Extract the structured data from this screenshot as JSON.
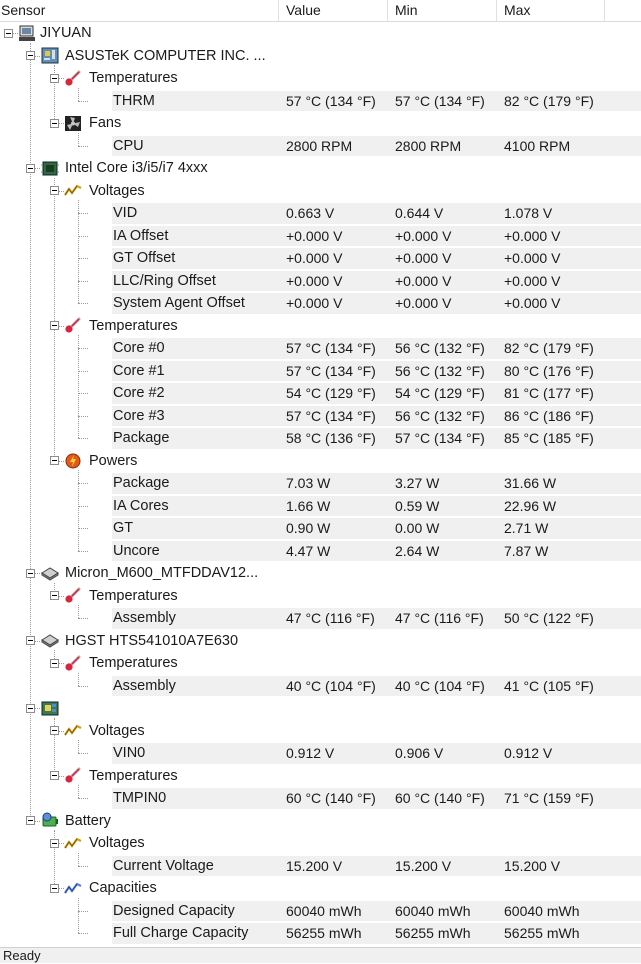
{
  "columns": {
    "sensor": "Sensor",
    "value": "Value",
    "min": "Min",
    "max": "Max"
  },
  "status": "Ready",
  "rows": [
    {
      "level": 0,
      "type": "computer",
      "icon": "computer-icon",
      "label": "JIYUAN"
    },
    {
      "level": 1,
      "type": "device",
      "icon": "motherboard-icon",
      "label": "ASUSTeK COMPUTER INC. ..."
    },
    {
      "level": 2,
      "type": "group",
      "icon": "thermometer-icon",
      "label": "Temperatures"
    },
    {
      "level": 3,
      "type": "sensor",
      "label": "THRM",
      "value": "57 °C  (134 °F)",
      "min": "57 °C  (134 °F)",
      "max": "82 °C  (179 °F)"
    },
    {
      "level": 2,
      "type": "group",
      "icon": "fan-icon",
      "label": "Fans"
    },
    {
      "level": 3,
      "type": "sensor",
      "label": "CPU",
      "value": "2800 RPM",
      "min": "2800 RPM",
      "max": "4100 RPM"
    },
    {
      "level": 1,
      "type": "device",
      "icon": "cpu-icon",
      "label": "Intel Core i3/i5/i7 4xxx"
    },
    {
      "level": 2,
      "type": "group",
      "icon": "voltage-icon",
      "label": "Voltages"
    },
    {
      "level": 3,
      "type": "sensor",
      "label": "VID",
      "value": "0.663 V",
      "min": "0.644 V",
      "max": "1.078 V"
    },
    {
      "level": 3,
      "type": "sensor",
      "label": "IA Offset",
      "value": "+0.000 V",
      "min": "+0.000 V",
      "max": "+0.000 V"
    },
    {
      "level": 3,
      "type": "sensor",
      "label": "GT Offset",
      "value": "+0.000 V",
      "min": "+0.000 V",
      "max": "+0.000 V"
    },
    {
      "level": 3,
      "type": "sensor",
      "label": "LLC/Ring Offset",
      "value": "+0.000 V",
      "min": "+0.000 V",
      "max": "+0.000 V"
    },
    {
      "level": 3,
      "type": "sensor",
      "label": "System Agent Offset",
      "value": "+0.000 V",
      "min": "+0.000 V",
      "max": "+0.000 V"
    },
    {
      "level": 2,
      "type": "group",
      "icon": "thermometer-icon",
      "label": "Temperatures"
    },
    {
      "level": 3,
      "type": "sensor",
      "label": "Core #0",
      "value": "57 °C  (134 °F)",
      "min": "56 °C  (132 °F)",
      "max": "82 °C  (179 °F)"
    },
    {
      "level": 3,
      "type": "sensor",
      "label": "Core #1",
      "value": "57 °C  (134 °F)",
      "min": "56 °C  (132 °F)",
      "max": "80 °C  (176 °F)"
    },
    {
      "level": 3,
      "type": "sensor",
      "label": "Core #2",
      "value": "54 °C  (129 °F)",
      "min": "54 °C  (129 °F)",
      "max": "81 °C  (177 °F)"
    },
    {
      "level": 3,
      "type": "sensor",
      "label": "Core #3",
      "value": "57 °C  (134 °F)",
      "min": "56 °C  (132 °F)",
      "max": "86 °C  (186 °F)"
    },
    {
      "level": 3,
      "type": "sensor",
      "label": "Package",
      "value": "58 °C  (136 °F)",
      "min": "57 °C  (134 °F)",
      "max": "85 °C  (185 °F)"
    },
    {
      "level": 2,
      "type": "group",
      "icon": "power-icon",
      "label": "Powers"
    },
    {
      "level": 3,
      "type": "sensor",
      "label": "Package",
      "value": "7.03 W",
      "min": "3.27 W",
      "max": "31.66 W"
    },
    {
      "level": 3,
      "type": "sensor",
      "label": "IA Cores",
      "value": "1.66 W",
      "min": "0.59 W",
      "max": "22.96 W"
    },
    {
      "level": 3,
      "type": "sensor",
      "label": "GT",
      "value": "0.90 W",
      "min": "0.00 W",
      "max": "2.71 W"
    },
    {
      "level": 3,
      "type": "sensor",
      "label": "Uncore",
      "value": "4.47 W",
      "min": "2.64 W",
      "max": "7.87 W"
    },
    {
      "level": 1,
      "type": "device",
      "icon": "disk-icon",
      "label": "Micron_M600_MTFDDAV12..."
    },
    {
      "level": 2,
      "type": "group",
      "icon": "thermometer-icon",
      "label": "Temperatures"
    },
    {
      "level": 3,
      "type": "sensor",
      "label": "Assembly",
      "value": "47 °C  (116 °F)",
      "min": "47 °C  (116 °F)",
      "max": "50 °C  (122 °F)"
    },
    {
      "level": 1,
      "type": "device",
      "icon": "disk-icon",
      "label": "HGST HTS541010A7E630"
    },
    {
      "level": 2,
      "type": "group",
      "icon": "thermometer-icon",
      "label": "Temperatures"
    },
    {
      "level": 3,
      "type": "sensor",
      "label": "Assembly",
      "value": "40 °C  (104 °F)",
      "min": "40 °C  (104 °F)",
      "max": "41 °C  (105 °F)"
    },
    {
      "level": 1,
      "type": "device",
      "icon": "chip-board-icon",
      "label": ""
    },
    {
      "level": 2,
      "type": "group",
      "icon": "voltage-icon",
      "label": "Voltages"
    },
    {
      "level": 3,
      "type": "sensor",
      "label": "VIN0",
      "value": "0.912 V",
      "min": "0.906 V",
      "max": "0.912 V"
    },
    {
      "level": 2,
      "type": "group",
      "icon": "thermometer-icon",
      "label": "Temperatures"
    },
    {
      "level": 3,
      "type": "sensor",
      "label": "TMPIN0",
      "value": "60 °C  (140 °F)",
      "min": "60 °C  (140 °F)",
      "max": "71 °C  (159 °F)"
    },
    {
      "level": 1,
      "type": "device",
      "icon": "battery-icon",
      "label": "Battery"
    },
    {
      "level": 2,
      "type": "group",
      "icon": "voltage-icon",
      "label": "Voltages"
    },
    {
      "level": 3,
      "type": "sensor",
      "label": "Current Voltage",
      "value": "15.200 V",
      "min": "15.200 V",
      "max": "15.200 V"
    },
    {
      "level": 2,
      "type": "group",
      "icon": "capacity-icon",
      "label": "Capacities"
    },
    {
      "level": 3,
      "type": "sensor",
      "label": "Designed Capacity",
      "value": "60040 mWh",
      "min": "60040 mWh",
      "max": "60040 mWh"
    },
    {
      "level": 3,
      "type": "sensor",
      "label": "Full Charge Capacity",
      "value": "56255 mWh",
      "min": "56255 mWh",
      "max": "56255 mWh"
    }
  ]
}
